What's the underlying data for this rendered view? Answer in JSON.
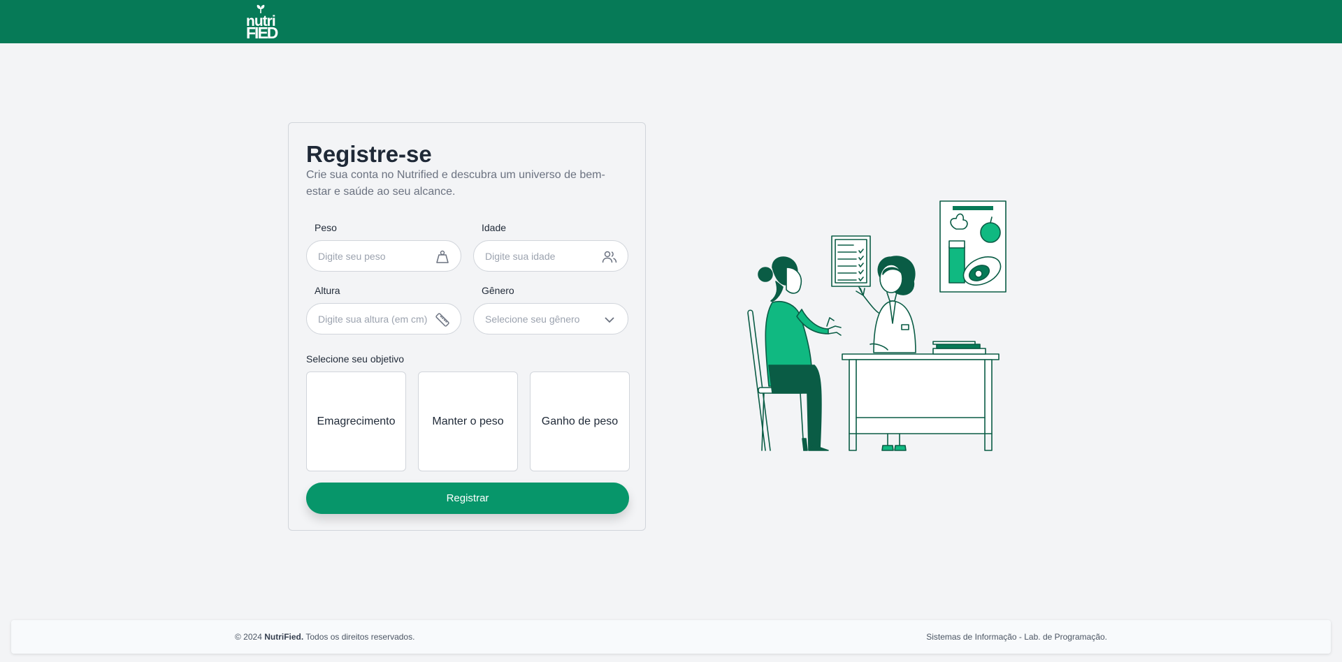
{
  "brand": {
    "line1": "nutri",
    "line2": "FIED"
  },
  "colors": {
    "primary": "#067a57",
    "button": "#07966a",
    "accent_light": "#10b981"
  },
  "form": {
    "title": "Registre-se",
    "subtitle": "Crie sua conta no Nutrified e descubra um universo de bem-estar e saúde ao seu alcance.",
    "peso": {
      "label": "Peso",
      "placeholder": "Digite seu peso",
      "icon": "weight-icon"
    },
    "idade": {
      "label": "Idade",
      "placeholder": "Digite sua idade",
      "icon": "users-icon"
    },
    "altura": {
      "label": "Altura",
      "placeholder": "Digite sua altura (em cm)",
      "icon": "ruler-icon"
    },
    "genero": {
      "label": "Gênero",
      "placeholder": "Selecione seu gênero",
      "icon": "chevron-down-icon"
    },
    "goal_label": "Selecione seu objetivo",
    "goals": [
      "Emagrecimento",
      "Manter o peso",
      "Ganho de peso"
    ],
    "submit_label": "Registrar"
  },
  "footer": {
    "copyright_prefix": "© 2024",
    "brand": "NutriFied.",
    "copyright_suffix": "Todos os direitos reservados.",
    "right": "Sistemas de Informação - Lab. de Programação."
  }
}
